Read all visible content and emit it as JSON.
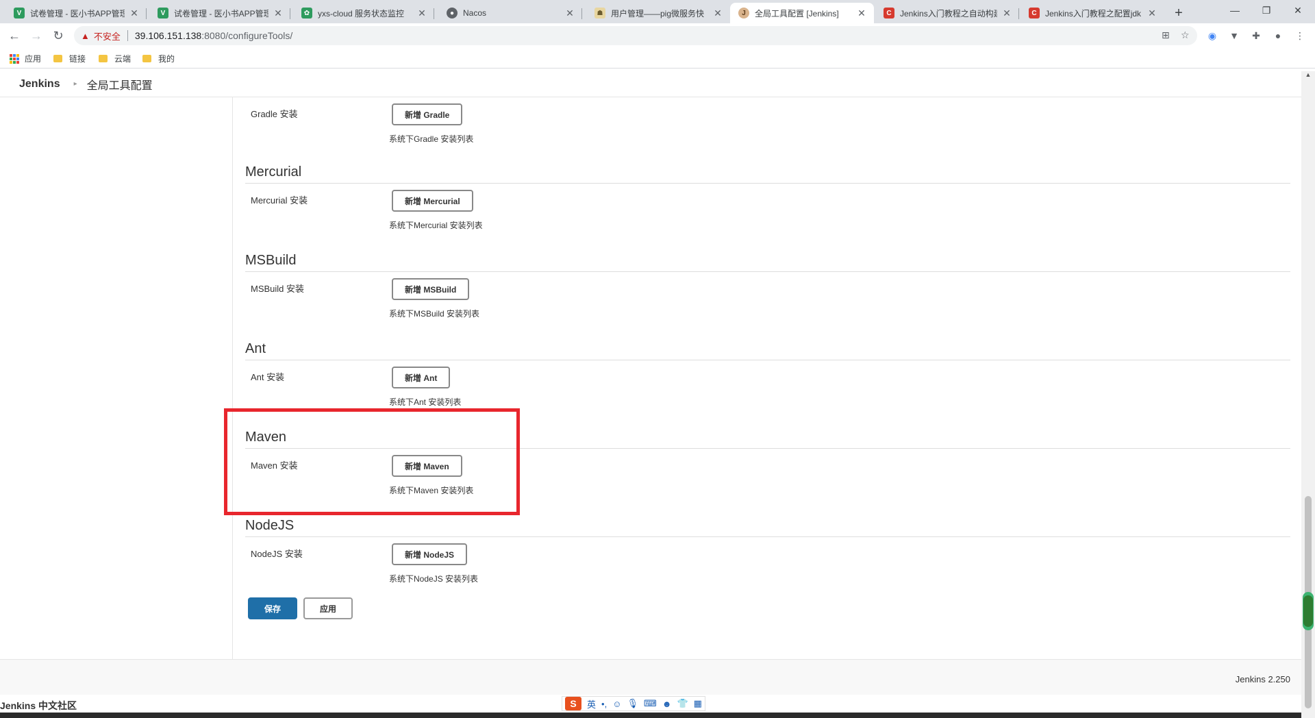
{
  "browser": {
    "tabs": [
      {
        "title": "试卷管理 - 医小书APP管理",
        "icon": "v-green-icon"
      },
      {
        "title": "试卷管理 - 医小书APP管理",
        "icon": "v-green-icon"
      },
      {
        "title": "yxs-cloud 服务状态监控",
        "icon": "monitor-icon"
      },
      {
        "title": "Nacos",
        "icon": "globe-icon"
      },
      {
        "title": "用户管理——pig微服务快",
        "icon": "pig-icon"
      },
      {
        "title": "全局工具配置 [Jenkins]",
        "icon": "jenkins-icon"
      },
      {
        "title": "Jenkins入门教程之自动构建",
        "icon": "csdn-icon"
      },
      {
        "title": "Jenkins入门教程之配置jdk",
        "icon": "csdn-icon"
      }
    ],
    "security_label": "不安全",
    "url_host": "39.106.151.138",
    "url_path": ":8080/configureTools/",
    "bookmarks": [
      "应用",
      "链接",
      "云端",
      "我的"
    ],
    "colors": {
      "tab_strip": "#dee1e6",
      "insecure": "#c5221f"
    }
  },
  "breadcrumb": {
    "root": "Jenkins",
    "page": "全局工具配置"
  },
  "tools": [
    {
      "title": "",
      "label": "Gradle 安装",
      "button": "新增 Gradle",
      "desc": "系统下Gradle 安装列表"
    },
    {
      "title": "Mercurial",
      "label": "Mercurial 安装",
      "button": "新增 Mercurial",
      "desc": "系统下Mercurial 安装列表"
    },
    {
      "title": "MSBuild",
      "label": "MSBuild 安装",
      "button": "新增 MSBuild",
      "desc": "系统下MSBuild 安装列表"
    },
    {
      "title": "Ant",
      "label": "Ant 安装",
      "button": "新增 Ant",
      "desc": "系统下Ant 安装列表"
    },
    {
      "title": "Maven",
      "label": "Maven 安装",
      "button": "新增 Maven",
      "desc": "系统下Maven 安装列表"
    },
    {
      "title": "NodeJS",
      "label": "NodeJS 安装",
      "button": "新增 NodeJS",
      "desc": "系统下NodeJS 安装列表"
    }
  ],
  "actions": {
    "save": "保存",
    "apply": "应用"
  },
  "footer": {
    "version": "Jenkins 2.250",
    "community": "Jenkins 中文社区"
  },
  "ime": {
    "logo": "S",
    "mode": "英",
    "punct": "•,"
  },
  "colors": {
    "primary_button": "#1f6fa8",
    "highlight_box": "#e8262d"
  }
}
